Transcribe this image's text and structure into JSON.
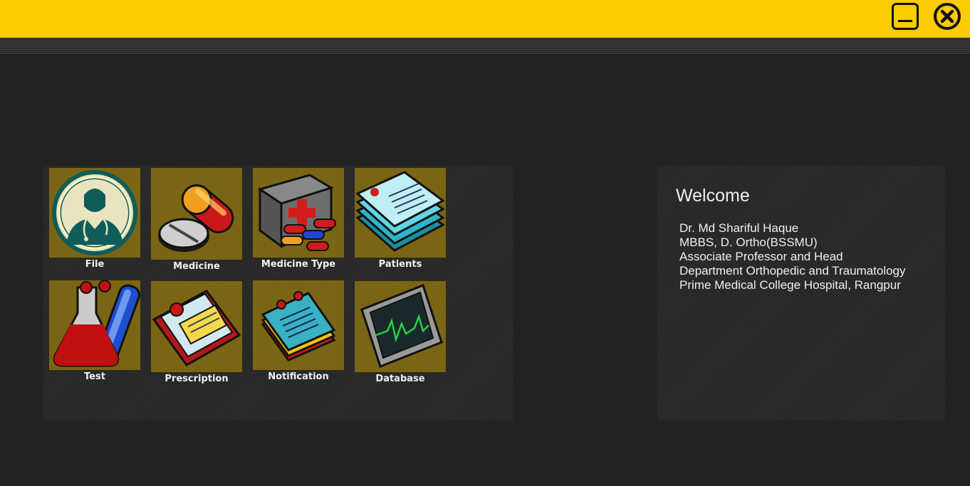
{
  "window": {
    "minimize_icon": "minimize-icon",
    "close_icon": "close-circle-icon",
    "accent_color": "#fccb00",
    "background_color": "#232323"
  },
  "menu": {
    "tile_color": "#7a6514",
    "items": [
      {
        "label": "File",
        "icon": "doctor-icon"
      },
      {
        "label": "Medicine",
        "icon": "pills-icon"
      },
      {
        "label": "Medicine Type",
        "icon": "medical-kit-icon"
      },
      {
        "label": "Patients",
        "icon": "patient-records-icon"
      },
      {
        "label": "Test",
        "icon": "lab-flask-icon"
      },
      {
        "label": "Prescription",
        "icon": "clipboard-icon"
      },
      {
        "label": "Notification",
        "icon": "notepad-icon"
      },
      {
        "label": "Database",
        "icon": "monitor-icon"
      }
    ]
  },
  "welcome": {
    "title": "Welcome",
    "lines": [
      "Dr. Md Shariful Haque",
      "MBBS, D. Ortho(BSSMU)",
      "Associate Professor and Head",
      "Department Orthopedic and Traumatology",
      "Prime Medical College Hospital, Rangpur"
    ]
  }
}
